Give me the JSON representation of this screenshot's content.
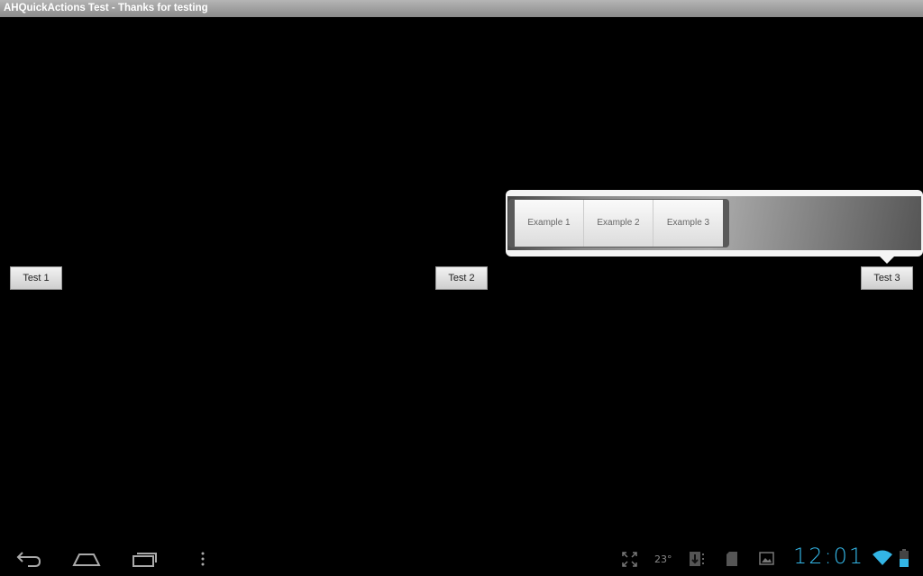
{
  "title": "AHQuickActions Test - Thanks for testing",
  "buttons": [
    "Test 1",
    "Test 2",
    "Test 3"
  ],
  "popup": {
    "items": [
      "Example 1",
      "Example 2",
      "Example 3"
    ]
  },
  "status": {
    "temperature": "23°",
    "time": "12:01",
    "accent": "#33b5e5"
  }
}
